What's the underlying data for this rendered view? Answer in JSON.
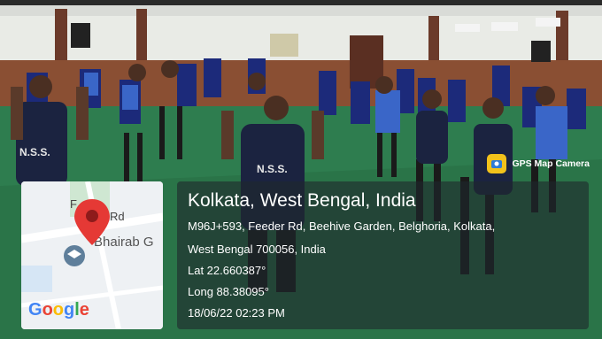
{
  "badge": {
    "label": "GPS Map Camera",
    "icon": "camera-pin-icon"
  },
  "map": {
    "road_label_1": "F",
    "road_label_2": "Rd",
    "place_label": "Bhairab G",
    "google": [
      "G",
      "o",
      "o",
      "g",
      "l",
      "e"
    ],
    "google_colors": [
      "#4285F4",
      "#EA4335",
      "#FBBC05",
      "#4285F4",
      "#34A853",
      "#EA4335"
    ]
  },
  "location": {
    "title": "Kolkata, West Bengal, India",
    "address_line1": "M96J+593, Feeder Rd, Beehive Garden, Belghoria, Kolkata,",
    "address_line2": "West Bengal 700056, India",
    "lat": "Lat 22.660387°",
    "long": "Long 88.38095°",
    "datetime": "18/06/22 02:23 PM"
  },
  "shirt_text": "N.S.S."
}
